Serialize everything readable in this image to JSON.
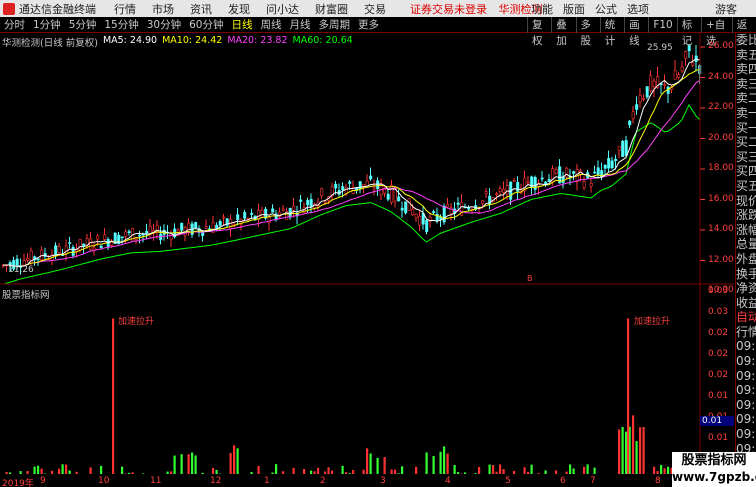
{
  "titlebar": {
    "app_title": "通达信金融终端",
    "menu": [
      "行情",
      "市场",
      "资讯",
      "发现",
      "问小达",
      "财富圈",
      "交易"
    ],
    "center_links": [
      "证券交易未登录",
      "华测检测"
    ],
    "right_menu": [
      "功能",
      "版面",
      "公式",
      "选项"
    ],
    "guest": "游客"
  },
  "toolbar": {
    "periods": [
      "分时",
      "1分钟",
      "5分钟",
      "15分钟",
      "30分钟",
      "60分钟",
      "日线",
      "周线",
      "月线",
      "多周期",
      "更多"
    ],
    "active_period": "日线",
    "right_tools": [
      "复权",
      "叠加",
      "多股",
      "统计",
      "画线",
      "F10",
      "标记",
      "+自选",
      "返回"
    ]
  },
  "legend": {
    "stock": "华测检测(日线 前复权)",
    "ma5": "MA5: 24.90",
    "ma10": "MA10: 24.42",
    "ma20": "MA20: 23.82",
    "ma60": "MA60: 20.64"
  },
  "colors": {
    "up": "#ff3232",
    "down": "#54ffff",
    "ma5": "#ffffff",
    "ma10": "#ffff00",
    "ma20": "#ff40ff",
    "ma60": "#00ff00",
    "vol_up": "#ff3232",
    "vol_down": "#32ff32"
  },
  "price_axis": [
    "26.00",
    "24.00",
    "22.00",
    "20.00",
    "18.00",
    "16.00",
    "14.00",
    "12.00",
    "10.00"
  ],
  "price_labels": {
    "peak": "25.95",
    "low": "11.26"
  },
  "indicator": {
    "title": "股票指标网",
    "axis": [
      "0.03",
      "0.03",
      "0.02",
      "0.02",
      "0.02",
      "0.01",
      "0.01",
      "0.01"
    ],
    "cursor_value": "0.01",
    "annotations": [
      "加速拉升",
      "加速拉升"
    ]
  },
  "date_axis": [
    "2019年",
    "9",
    "10",
    "11",
    "12",
    "1",
    "2",
    "3",
    "4",
    "5",
    "6",
    "7",
    "8"
  ],
  "sidebar": [
    "委比",
    "卖五",
    "卖四",
    "卖三",
    "卖二",
    "卖一",
    "买一",
    "买二",
    "买三",
    "买四",
    "买五",
    "现价",
    "涨跌",
    "涨幅",
    "总量",
    "外盘",
    "换手",
    "净资",
    "收益",
    "自动",
    "行情",
    "09:30",
    "09:30",
    "09:30",
    "09:30",
    "09:30",
    "09:30",
    "09:30",
    "09:30",
    "09:30",
    "09:30",
    "09:30"
  ],
  "marker_b": "B",
  "watermark": {
    "line1": "股票指标网",
    "line2": "www.7gpzb.com"
  },
  "chart_data": {
    "type": "candlestick",
    "ylim": [
      9.8,
      26.8
    ],
    "ma5_last": 24.9,
    "ma10_last": 24.42,
    "ma20_last": 23.82,
    "ma60_last": 20.64,
    "peak": 25.95,
    "low": 11.26,
    "indicator_ylim": [
      0,
      0.035
    ],
    "indicator_spikes": [
      0.033,
      0.033
    ]
  }
}
